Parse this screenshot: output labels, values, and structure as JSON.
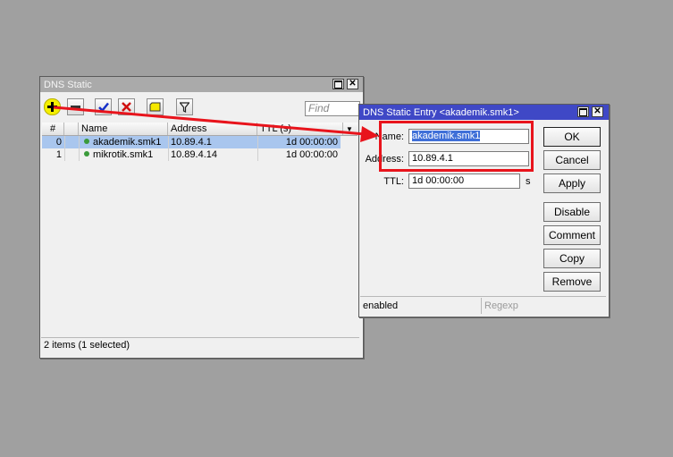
{
  "dns_static": {
    "title": "DNS Static",
    "find_placeholder": "Find",
    "columns": [
      "#",
      "Name",
      "Address",
      "TTL (s)"
    ],
    "rows": [
      {
        "index": "0",
        "name": "akademik.smk1",
        "address": "10.89.4.1",
        "ttl": "1d 00:00:00",
        "selected": true
      },
      {
        "index": "1",
        "name": "mikrotik.smk1",
        "address": "10.89.4.14",
        "ttl": "1d 00:00:00",
        "selected": false
      }
    ],
    "status": "2 items (1 selected)",
    "toolbar_icons": [
      "add-icon",
      "remove-icon",
      "enable-check-icon",
      "disable-x-icon",
      "comment-note-icon",
      "filter-funnel-icon"
    ]
  },
  "entry": {
    "title": "DNS Static Entry <akademik.smk1>",
    "name_label": "Name:",
    "name_value": "akademik.smk1",
    "address_label": "Address:",
    "address_value": "10.89.4.1",
    "ttl_label": "TTL:",
    "ttl_value": "1d 00:00:00",
    "ttl_unit": "s",
    "buttons": {
      "ok": "OK",
      "cancel": "Cancel",
      "apply": "Apply",
      "disable": "Disable",
      "comment": "Comment",
      "copy": "Copy",
      "remove": "Remove"
    },
    "status_left": "enabled",
    "status_right": "Regexp"
  },
  "colors": {
    "desktop": "#a0a0a0",
    "active_title": "#3f48c6",
    "selection": "#a9c6ee",
    "annotation": "#e8141c",
    "highlight": "#f5f000"
  }
}
